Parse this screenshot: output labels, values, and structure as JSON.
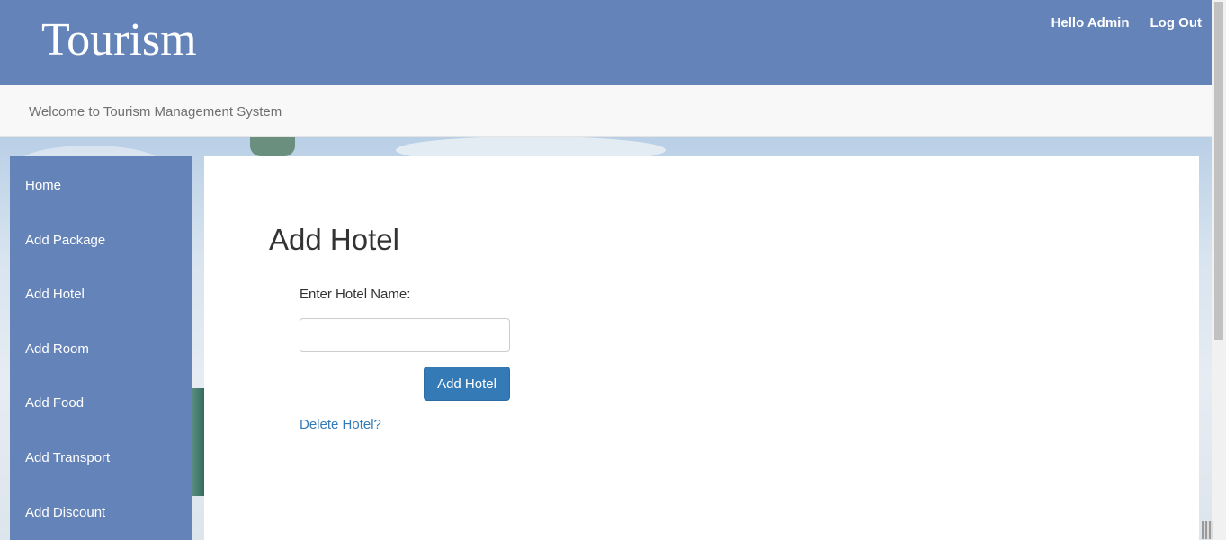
{
  "header": {
    "brand": "Tourism",
    "greeting": "Hello Admin",
    "logout": "Log Out"
  },
  "welcome": "Welcome to Tourism Management System",
  "sidebar": {
    "items": [
      {
        "label": "Home"
      },
      {
        "label": "Add Package"
      },
      {
        "label": "Add Hotel"
      },
      {
        "label": "Add Room"
      },
      {
        "label": "Add Food"
      },
      {
        "label": "Add Transport"
      },
      {
        "label": "Add Discount"
      }
    ]
  },
  "form": {
    "title": "Add Hotel",
    "label": "Enter Hotel Name:",
    "input_value": "",
    "input_placeholder": "",
    "submit_label": "Add Hotel",
    "delete_link": "Delete Hotel?"
  },
  "colors": {
    "header_bg": "#6483b9",
    "button_bg": "#337ab7",
    "link": "#337ab7"
  }
}
